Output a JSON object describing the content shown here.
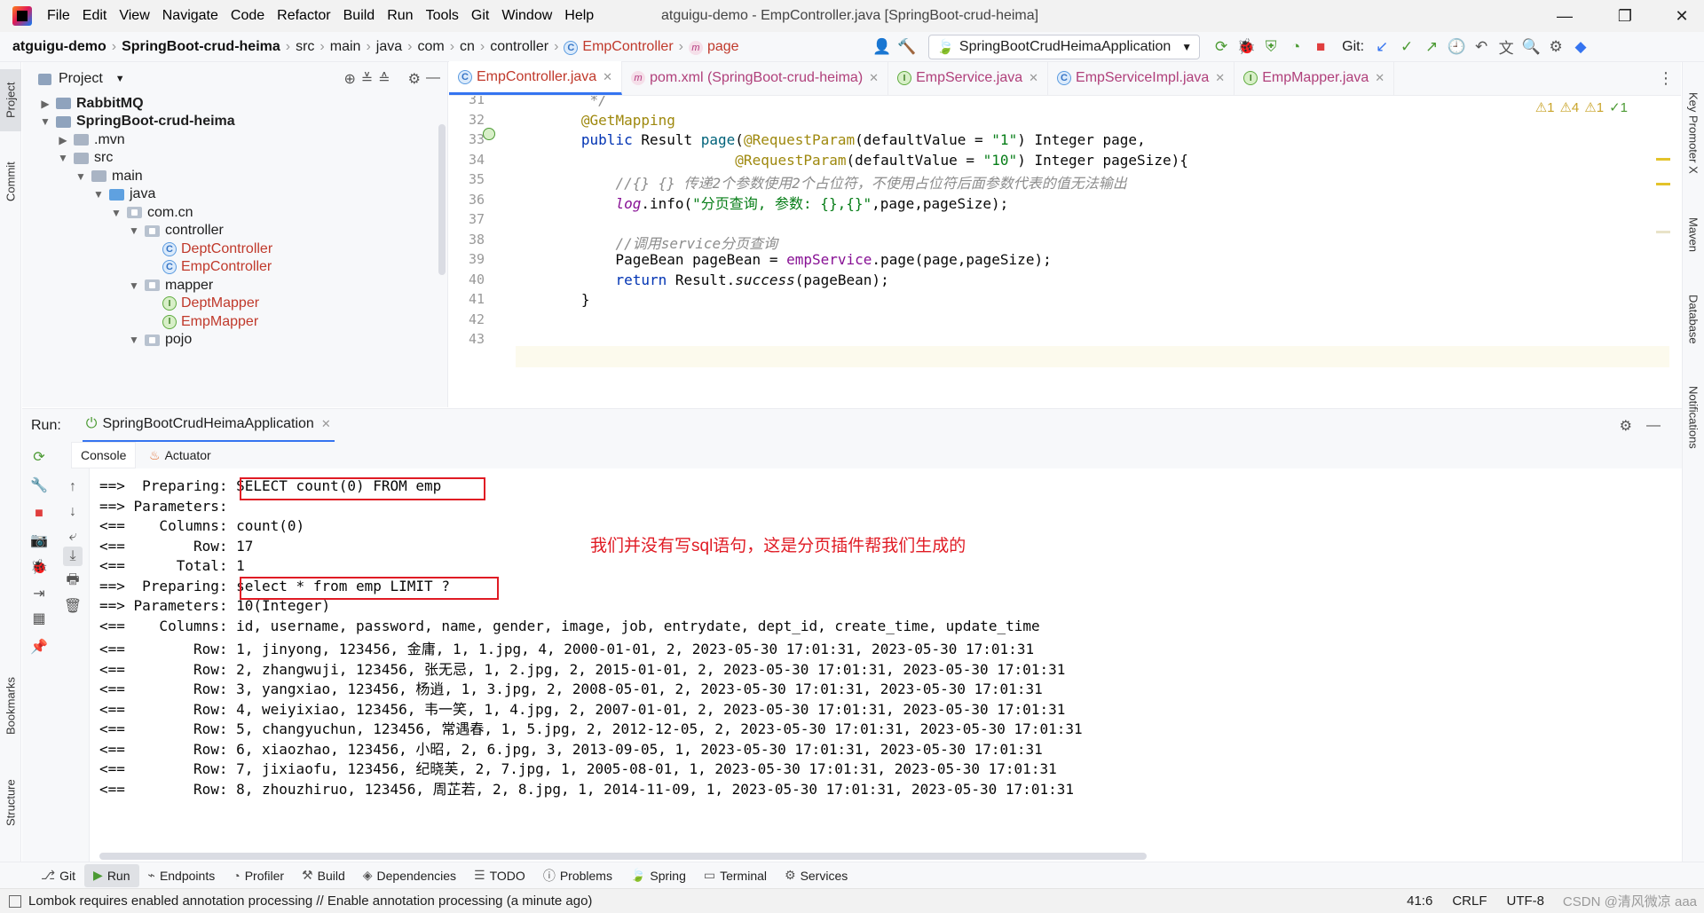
{
  "window": {
    "menu": [
      "File",
      "Edit",
      "View",
      "Navigate",
      "Code",
      "Refactor",
      "Build",
      "Run",
      "Tools",
      "Git",
      "Window",
      "Help"
    ],
    "title": "atguigu-demo - EmpController.java [SpringBoot-crud-heima]"
  },
  "navbar": {
    "breadcrumbs": [
      "atguigu-demo",
      "SpringBoot-crud-heima",
      "src",
      "main",
      "java",
      "com",
      "cn",
      "controller",
      "EmpController",
      "page"
    ],
    "run_config": "SpringBootCrudHeimaApplication",
    "git_label": "Git:"
  },
  "project": {
    "title": "Project",
    "tree": [
      {
        "label": "RabbitMQ",
        "depth": 0,
        "arrow": "▶",
        "kind": "module",
        "bold": true
      },
      {
        "label": "SpringBoot-crud-heima",
        "depth": 0,
        "arrow": "▼",
        "kind": "module",
        "bold": true
      },
      {
        "label": ".mvn",
        "depth": 1,
        "arrow": "▶",
        "kind": "folder"
      },
      {
        "label": "src",
        "depth": 1,
        "arrow": "▼",
        "kind": "folder"
      },
      {
        "label": "main",
        "depth": 2,
        "arrow": "▼",
        "kind": "folder"
      },
      {
        "label": "java",
        "depth": 3,
        "arrow": "▼",
        "kind": "blue"
      },
      {
        "label": "com.cn",
        "depth": 4,
        "arrow": "▼",
        "kind": "pkg"
      },
      {
        "label": "controller",
        "depth": 5,
        "arrow": "▼",
        "kind": "pkg"
      },
      {
        "label": "DeptController",
        "depth": 6,
        "arrow": "",
        "kind": "class"
      },
      {
        "label": "EmpController",
        "depth": 6,
        "arrow": "",
        "kind": "class"
      },
      {
        "label": "mapper",
        "depth": 5,
        "arrow": "▼",
        "kind": "pkg"
      },
      {
        "label": "DeptMapper",
        "depth": 6,
        "arrow": "",
        "kind": "iface"
      },
      {
        "label": "EmpMapper",
        "depth": 6,
        "arrow": "",
        "kind": "iface"
      },
      {
        "label": "pojo",
        "depth": 5,
        "arrow": "▼",
        "kind": "pkg"
      }
    ]
  },
  "editor": {
    "tabs": [
      {
        "label": "EmpController.java",
        "icon": "C",
        "active": true
      },
      {
        "label": "pom.xml (SpringBoot-crud-heima)",
        "icon": "m",
        "active": false
      },
      {
        "label": "EmpService.java",
        "icon": "I",
        "active": false
      },
      {
        "label": "EmpServiceImpl.java",
        "icon": "C",
        "active": false
      },
      {
        "label": "EmpMapper.java",
        "icon": "I",
        "active": false
      }
    ],
    "inspections": [
      "⚠1",
      "⚠4",
      "⚠1",
      "✓1"
    ],
    "lines": [
      {
        "n": "31",
        "html": "    <span class=\"cmt\">*/</span>"
      },
      {
        "n": "32",
        "html": "   <span class=\"ann\">@GetMapping</span>"
      },
      {
        "n": "33",
        "html": "   <span class=\"kw\">public</span> Result <span style=\"color:#00627a\">page</span>(<span class=\"ann\">@RequestParam</span>(defaultValue = <span class=\"str\">\"1\"</span>) Integer page,"
      },
      {
        "n": "34",
        "html": "                     <span class=\"ann\">@RequestParam</span>(defaultValue = <span class=\"str\">\"10\"</span>) Integer pageSize){"
      },
      {
        "n": "35",
        "html": "       <span class=\"cmt\">//{} {} 传递2个参数使用2个占位符，不使用占位符后面参数代表的值无法输出</span>"
      },
      {
        "n": "36",
        "html": "       <span class=\"fld it\">log</span>.info(<span class=\"str\">\"分页查询, 参数: {},{}\"</span>,page,pageSize);"
      },
      {
        "n": "37",
        "html": ""
      },
      {
        "n": "38",
        "html": "       <span class=\"cmt\">//调用service分页查询</span>"
      },
      {
        "n": "39",
        "html": "       PageBean pageBean = <span class=\"fld\">empService</span>.page(page,pageSize);"
      },
      {
        "n": "40",
        "html": "       <span class=\"kw\">return</span> Result.<span class=\"it\">success</span>(pageBean);"
      },
      {
        "n": "41",
        "html": "   }"
      },
      {
        "n": "42",
        "html": ""
      },
      {
        "n": "43",
        "html": ""
      }
    ]
  },
  "run": {
    "label": "Run:",
    "tab": "SpringBootCrudHeimaApplication",
    "subtabs": [
      "Console",
      "Actuator"
    ],
    "annotation": "我们并没有写sql语句，这是分页插件帮我们生成的",
    "console": [
      "==>  Preparing: SELECT count(0) FROM emp",
      "==> Parameters: ",
      "<==    Columns: count(0)",
      "<==        Row: 17",
      "<==      Total: 1",
      "==>  Preparing: select * from emp LIMIT ?",
      "==> Parameters: 10(Integer)",
      "<==    Columns: id, username, password, name, gender, image, job, entrydate, dept_id, create_time, update_time",
      "<==        Row: 1, jinyong, 123456, 金庸, 1, 1.jpg, 4, 2000-01-01, 2, 2023-05-30 17:01:31, 2023-05-30 17:01:31",
      "<==        Row: 2, zhangwuji, 123456, 张无忌, 1, 2.jpg, 2, 2015-01-01, 2, 2023-05-30 17:01:31, 2023-05-30 17:01:31",
      "<==        Row: 3, yangxiao, 123456, 杨逍, 1, 3.jpg, 2, 2008-05-01, 2, 2023-05-30 17:01:31, 2023-05-30 17:01:31",
      "<==        Row: 4, weiyixiao, 123456, 韦一笑, 1, 4.jpg, 2, 2007-01-01, 2, 2023-05-30 17:01:31, 2023-05-30 17:01:31",
      "<==        Row: 5, changyuchun, 123456, 常遇春, 1, 5.jpg, 2, 2012-12-05, 2, 2023-05-30 17:01:31, 2023-05-30 17:01:31",
      "<==        Row: 6, xiaozhao, 123456, 小昭, 2, 6.jpg, 3, 2013-09-05, 1, 2023-05-30 17:01:31, 2023-05-30 17:01:31",
      "<==        Row: 7, jixiaofu, 123456, 纪晓芙, 2, 7.jpg, 1, 2005-08-01, 1, 2023-05-30 17:01:31, 2023-05-30 17:01:31",
      "<==        Row: 8, zhouzhiruo, 123456, 周芷若, 2, 8.jpg, 1, 2014-11-09, 1, 2023-05-30 17:01:31, 2023-05-30 17:01:31"
    ]
  },
  "right_strip": [
    "Key Promoter X",
    "Maven",
    "Database",
    "Notifications"
  ],
  "left_strip": [
    "Project",
    "Commit",
    "Bookmarks",
    "Structure"
  ],
  "bottom_tabs": [
    {
      "label": "Git",
      "active": false
    },
    {
      "label": "Run",
      "active": true
    },
    {
      "label": "Endpoints",
      "active": false
    },
    {
      "label": "Profiler",
      "active": false
    },
    {
      "label": "Build",
      "active": false
    },
    {
      "label": "Dependencies",
      "active": false
    },
    {
      "label": "TODO",
      "active": false
    },
    {
      "label": "Problems",
      "active": false
    },
    {
      "label": "Spring",
      "active": false
    },
    {
      "label": "Terminal",
      "active": false
    },
    {
      "label": "Services",
      "active": false
    }
  ],
  "status": {
    "message": "Lombok requires enabled annotation processing // Enable annotation processing (a minute ago)",
    "position": "41:6",
    "line_sep": "CRLF",
    "encoding": "UTF-8",
    "watermark": "CSDN @清风微凉 aaa"
  }
}
